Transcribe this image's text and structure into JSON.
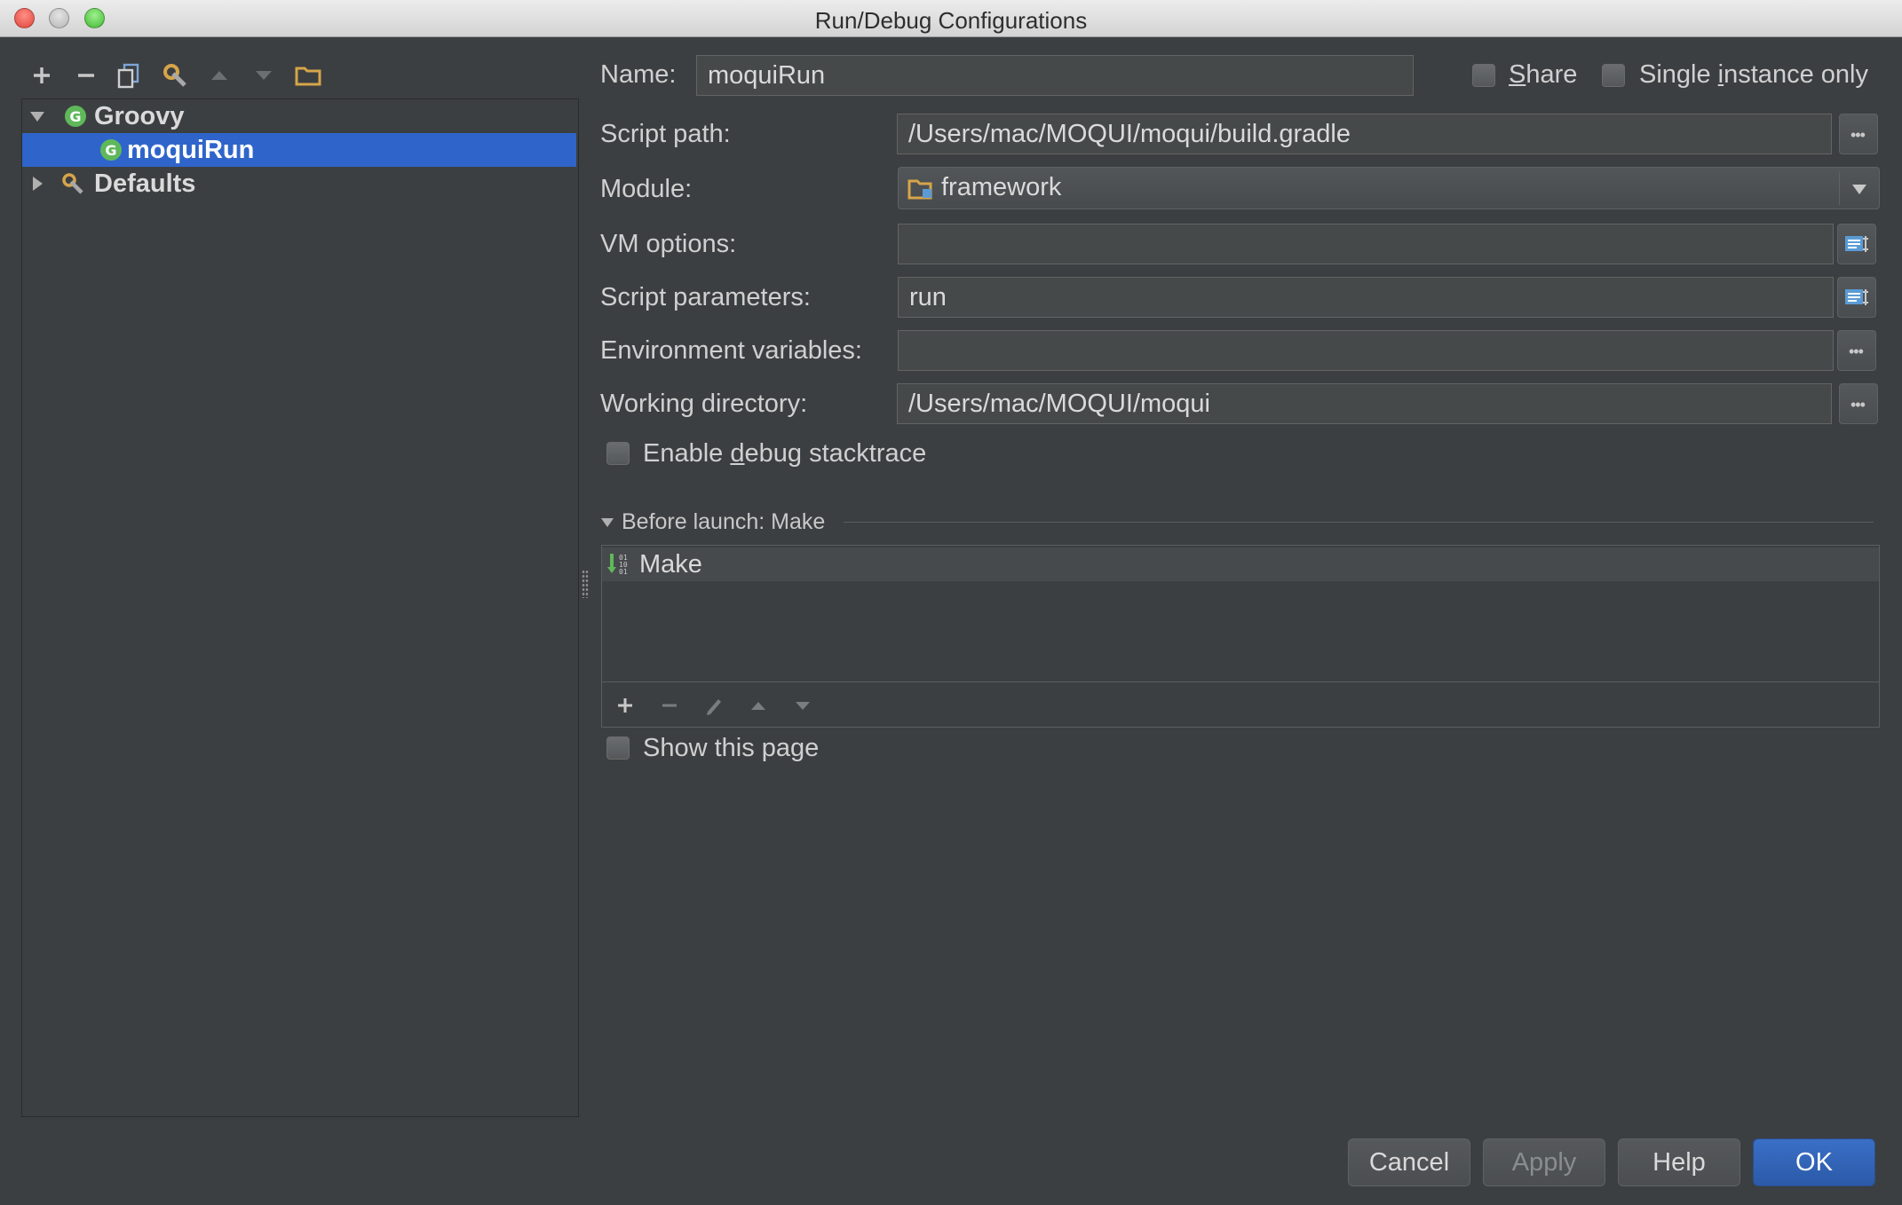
{
  "window": {
    "title": "Run/Debug Configurations"
  },
  "toolbar": {
    "icons": [
      "add-icon",
      "remove-icon",
      "copy-icon",
      "edit-defaults-icon",
      "move-up-icon",
      "move-down-icon",
      "folder-icon"
    ]
  },
  "tree": {
    "groovy": {
      "label": "Groovy"
    },
    "config": {
      "label": "moquiRun"
    },
    "defaults": {
      "label": "Defaults"
    }
  },
  "form": {
    "name": {
      "label": "Name:",
      "value": "moquiRun"
    },
    "share": {
      "label_pre": "",
      "label_u": "S",
      "label_post": "hare",
      "checked": false
    },
    "single_instance": {
      "label_pre": "Single ",
      "label_u": "i",
      "label_post": "nstance only",
      "checked": false
    },
    "script_path": {
      "label": "Script path:",
      "value": "/Users/mac/MOQUI/moqui/build.gradle"
    },
    "module": {
      "label": "Module:",
      "value": "framework"
    },
    "vm_options": {
      "label": "VM options:",
      "value": ""
    },
    "script_parameters": {
      "label": "Script parameters:",
      "value": "run"
    },
    "env_vars": {
      "label": "Environment variables:",
      "value": ""
    },
    "working_dir": {
      "label": "Working directory:",
      "value": "/Users/mac/MOQUI/moqui"
    },
    "debug_stacktrace": {
      "label_pre": "Enable ",
      "label_u": "d",
      "label_post": "ebug stacktrace",
      "checked": false
    }
  },
  "before_launch": {
    "title": "Before launch: Make",
    "items": [
      {
        "label": "Make"
      }
    ]
  },
  "show_page": {
    "label": "Show this page",
    "checked": false
  },
  "buttons": {
    "cancel": "Cancel",
    "apply": "Apply",
    "help": "Help",
    "ok": "OK"
  },
  "colors": {
    "background": "#3c3f41",
    "selection": "#2f65ca",
    "field_bg": "#45494a",
    "groovy_green": "#5fb85a",
    "default_button": "#2b5aa8"
  }
}
